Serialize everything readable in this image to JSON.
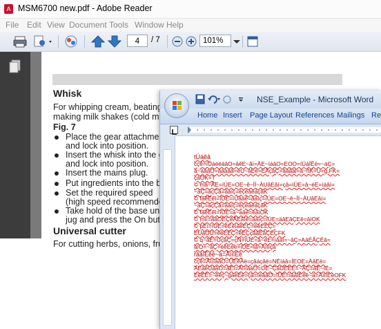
{
  "reader": {
    "title": "MSM6700 new.pdf - Adobe Reader",
    "menu": [
      "File",
      "Edit",
      "View",
      "Document",
      "Tools",
      "Window",
      "Help"
    ],
    "toolbar": {
      "current_page": "4",
      "page_total": "/ 7",
      "zoom": "101%"
    },
    "pdf": {
      "heading_whisk": "Whisk",
      "intro_1": "For whipping cream, beating e",
      "intro_2": "making milk shakes (cold milk",
      "fig": "Fig. 7",
      "bullets": [
        "Place the gear attachment",
        "and lock into position.",
        "Insert the whisk into the ge",
        "and lock into position.",
        "Insert the mains plug.",
        "Put ingredients into the ble",
        "Set the required speed",
        "(high speed recommende",
        "Take hold of the base unit",
        "jug and press the On butto"
      ],
      "heading_cutter": "Universal cutter",
      "cutter_text": "For cutting herbs, onions, fruit"
    }
  },
  "word": {
    "title": "NSE_Example - Microsoft Word",
    "tabs": [
      "Home",
      "Insert",
      "Page Layout",
      "References",
      "Mailings",
      "Re"
    ],
    "lines": [
      "tÚáêâ",
      "cçê=íÚáéëáâO=âêE~ãì=ÄE~íáâO=EOO=íÚáÍËë=~áÇ=",
      "ä~áâáO=âáàáâ=ëU~áEë=EÃçáÇ=âáâäl=ä~ñK=U=g.FK=",
      "çáOK=T",
      "©  má~ÃE=íÚE=OE~ê~ÍÍ~ÀUâEâí=çâ=íÚE=â~éE=íáâí=",
      "~áÇ=äçÇâ=âáíç=éçëáéáçâK",
      "©  fâêËêí=íÚE=íÚáâê=âáíç=íÚE=OE~ê~ÍÍ~ÀUâEâí=",
      "~áÇ=äçÇâ=âáíç=éçëáéáçâK",
      "©  fâêËêí=íÚE=ã~áâë=éäìOK",
      "©  mìí=âäOËÇêÂEâíé=âáíç=íÚE=äâEâÇEê=âìOK",
      "©  pÉí=íÚE=êÉèìáêÉÇ=ëéÉÉÇ=",
      "EÚáOÚ=ëéÉÉÇ=êÉÇçããÉâÇÉÇFK",
      "©  q~âÉ=ÚçäÇ=çÑ=íÚÉ=â~ëÉ=ìâáí=~âÇ=AâÉÃÇÉâ=",
      "âìO=~âÇ=éêÉëë=íÚÉ=lâ=Äìííçâ",
      "râáîÉêë~ä=ÅìííÉê",
      "cçê=ÅìííáâO=ÚÉêÄë=çâáçâë=NÉíáâ=ÍEOE=ÄâEë=",
      "ÄÉäéÚáâO=âÉí=ÄìííáâO=UÉ~ÇâÜÉEÉ=~ÂÇ=âÉ~íÉ=",
      "EëÉÉ=~êéç~gáëÉë=çâ=íéâáO=íÚÉ=íáâíÉêë~ä=ÅìííÉêOFK"
    ]
  },
  "colors": {
    "reader_left_pane": "#3c3c3c",
    "reader_doc_background": "#7a7a7a",
    "word_ribbon": "#c6d7ee",
    "word_tab_text": "#15428b",
    "word_text": "#b00000"
  }
}
